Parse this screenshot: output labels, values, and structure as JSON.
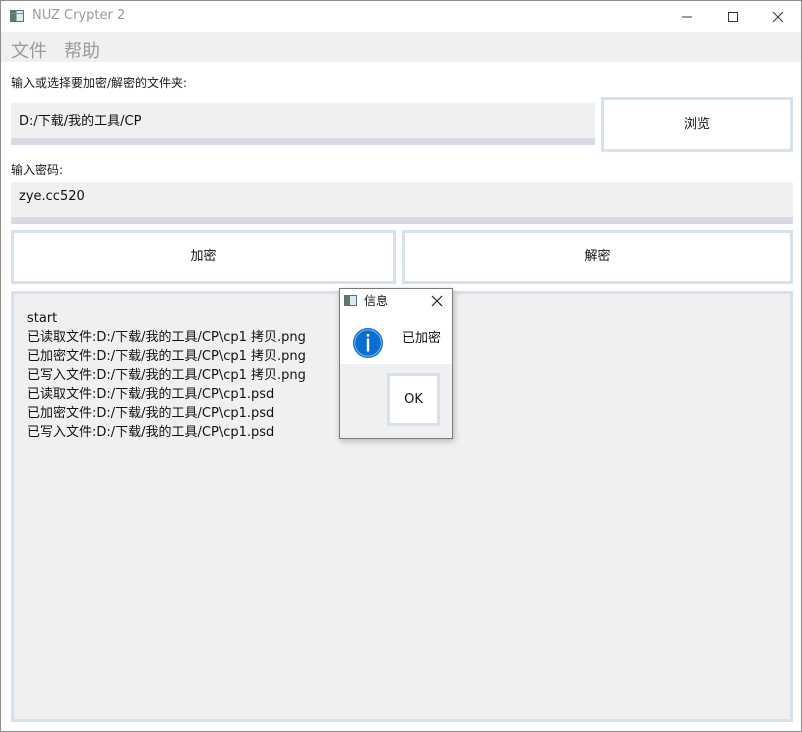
{
  "window": {
    "title": "NUZ Crypter 2"
  },
  "menu": {
    "file": "文件",
    "help": "帮助"
  },
  "folder": {
    "label": "输入或选择要加密/解密的文件夹:",
    "value": "D:/下载/我的工具/CP",
    "browse_label": "浏览"
  },
  "password": {
    "label": "输入密码:",
    "value": "zye.cc520"
  },
  "actions": {
    "encrypt_label": "加密",
    "decrypt_label": "解密"
  },
  "log": {
    "lines": [
      "start",
      "已读取文件:D:/下载/我的工具/CP\\cp1 拷贝.png",
      "已加密文件:D:/下载/我的工具/CP\\cp1 拷贝.png",
      "已写入文件:D:/下载/我的工具/CP\\cp1 拷贝.png",
      "已读取文件:D:/下载/我的工具/CP\\cp1.psd",
      "已加密文件:D:/下载/我的工具/CP\\cp1.psd",
      "已写入文件:D:/下载/我的工具/CP\\cp1.psd"
    ]
  },
  "dialog": {
    "title": "信息",
    "message": "已加密",
    "ok_label": "OK",
    "icon": "info-icon"
  },
  "colors": {
    "button_border": "#d4e2f0",
    "field_background": "#f0f0f0",
    "field_underline": "#d8d8e6",
    "info_blue": "#0a6fd1"
  }
}
